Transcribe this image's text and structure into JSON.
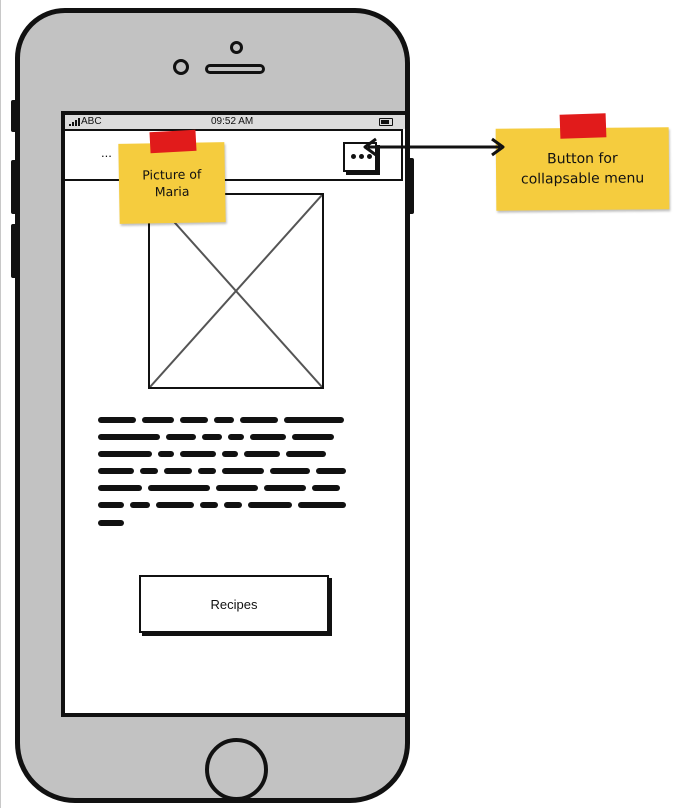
{
  "status_bar": {
    "carrier": "ABC",
    "time": "09:52 AM"
  },
  "nav_bar": {
    "title": "...",
    "menu_button_icon": "more-dots-icon"
  },
  "picture": {
    "note": "Picture of\nMaria"
  },
  "recipes_button": {
    "label": "Recipes"
  },
  "annotation": {
    "note": "Button for\ncollapsable menu"
  },
  "colors": {
    "sticky": "#f5cc3e",
    "tape": "#e11b1b",
    "phone_body": "#c2c2c2"
  }
}
